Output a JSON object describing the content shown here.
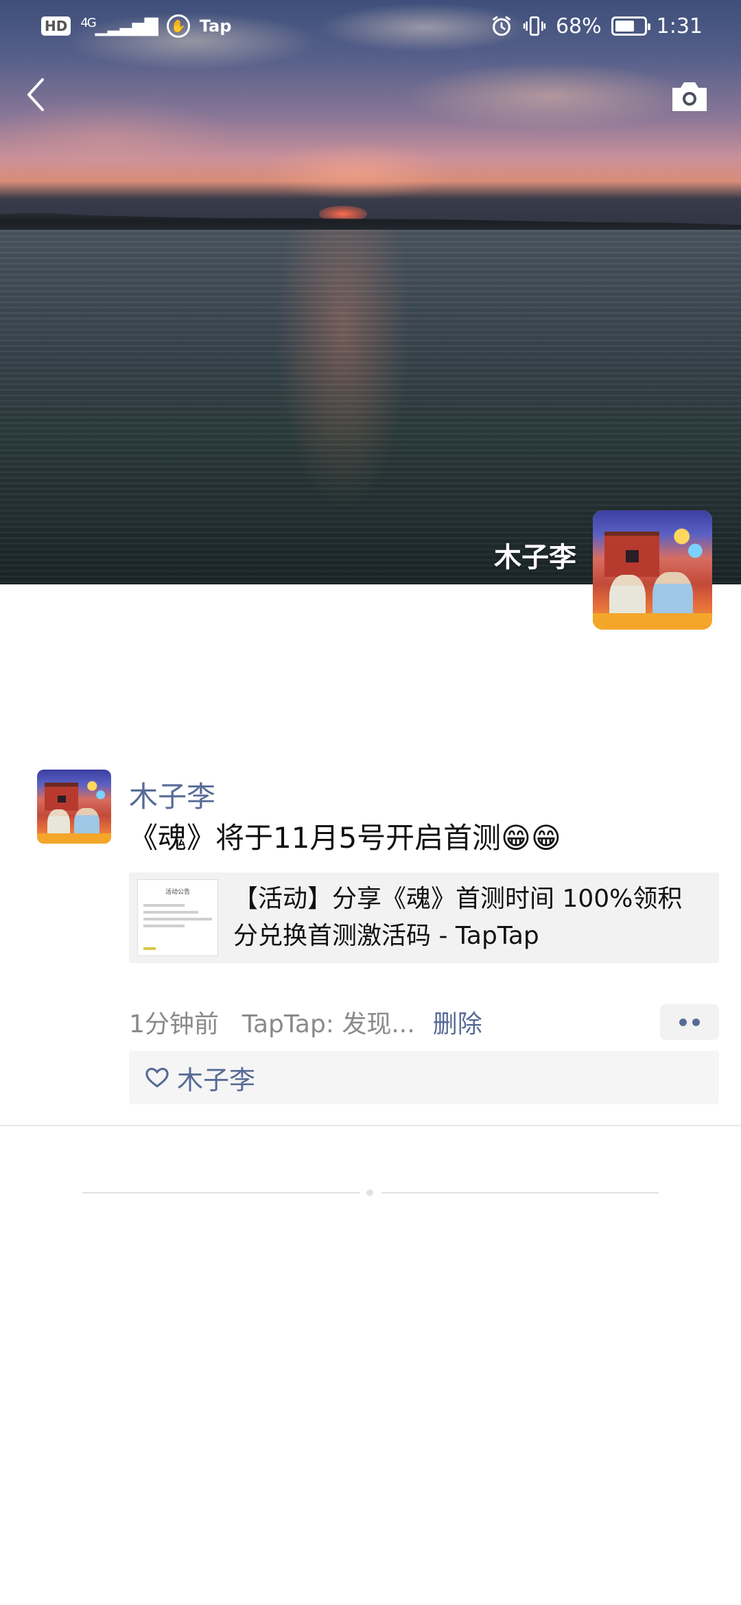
{
  "status_bar": {
    "hd": "HD",
    "network": "4G",
    "tap_label": "Tap",
    "battery": "68%",
    "time": "1:31",
    "icons": [
      "hd-badge",
      "signal-icon",
      "tap-app-icon",
      "alarm-icon",
      "vibrate-icon",
      "battery-icon"
    ]
  },
  "header": {
    "back_icon": "chevron-left-icon",
    "camera_icon": "camera-icon"
  },
  "profile": {
    "name": "木子李"
  },
  "post": {
    "author": "木子李",
    "text": "《魂》将于11月5号开启首测😁😁",
    "link": {
      "title": "【活动】分享《魂》首测时间 100%领积分兑换首测激活码 - TapTap",
      "thumb_title": "活动公告"
    },
    "time": "1分钟前",
    "source": "TapTap: 发现...",
    "delete_label": "删除",
    "likes": "木子李"
  },
  "colors": {
    "link_blue": "#576b95",
    "meta_gray": "#8a8a8a",
    "card_bg": "#f2f2f2"
  }
}
